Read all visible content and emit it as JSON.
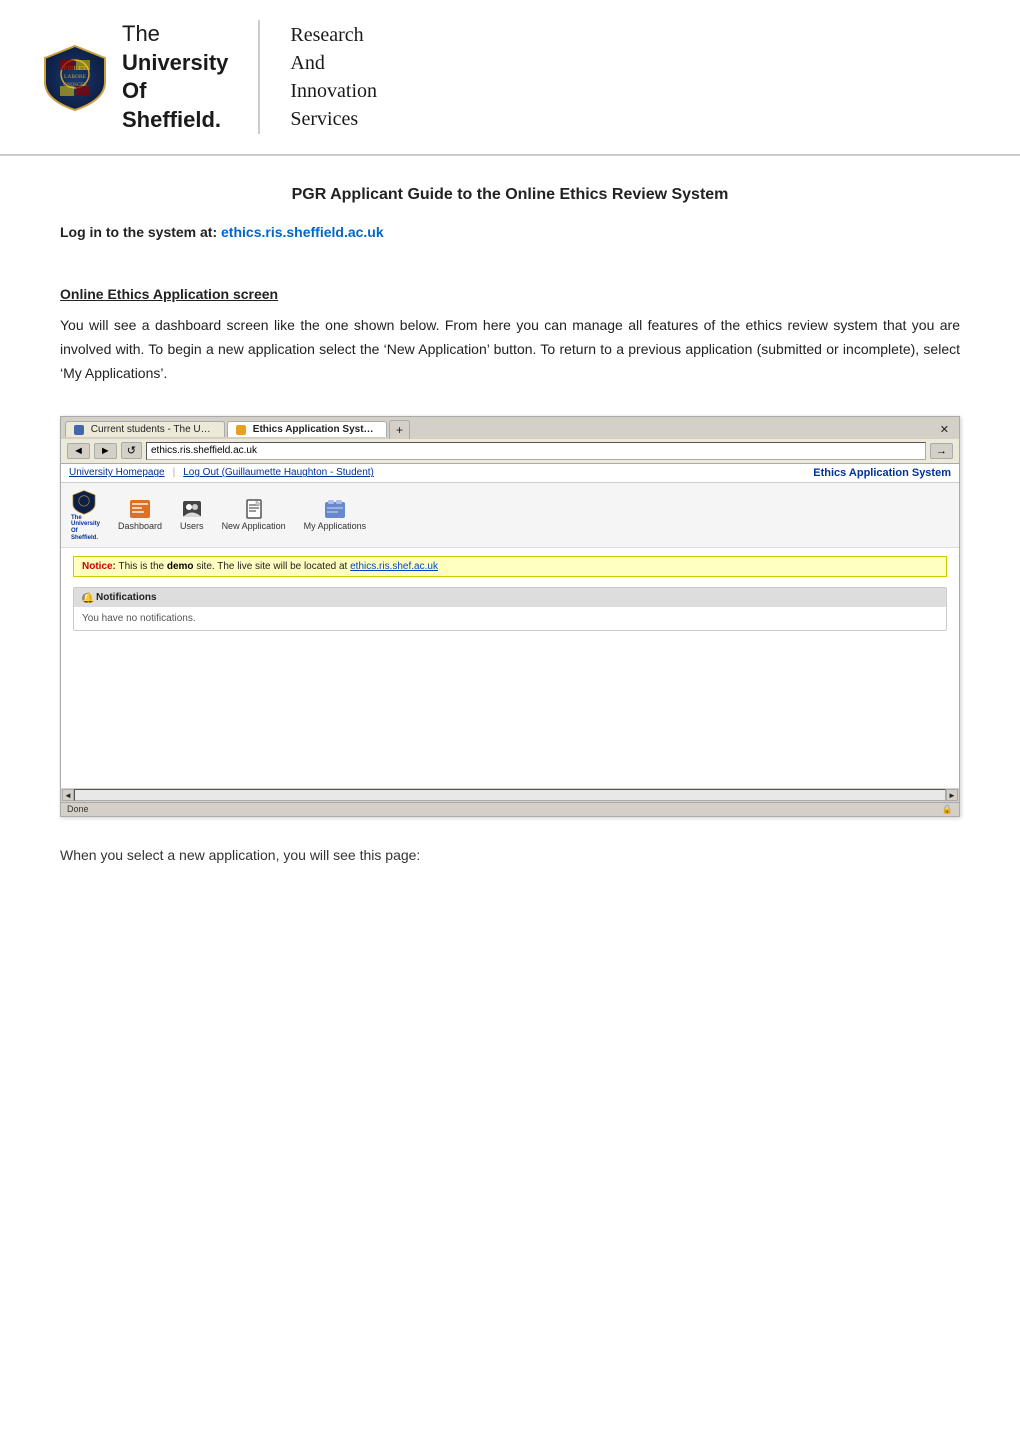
{
  "header": {
    "uni_line1": "The",
    "uni_line2": "University",
    "uni_line3": "Of",
    "uni_line4": "Sheffield.",
    "ris_line1": "Research",
    "ris_line2": "And",
    "ris_line3": "Innovation",
    "ris_line4": "Services"
  },
  "page": {
    "title": "PGR Applicant Guide to the Online Ethics Review System",
    "login_label": "Log in to the system at:",
    "login_link": "ethics.ris.sheffield.ac.uk",
    "section_heading": "Online Ethics Application screen",
    "section_body": "You will see a dashboard screen like the one shown below. From here you can manage all features of the ethics review system that you are involved with. To begin a new application select the ‘New Application’ button. To return to a previous application (submitted or incomplete), select ‘My Applications’.",
    "footer_text": "When you select a new application, you will see this page:"
  },
  "browser": {
    "tab1_label": "Current students - The University of S...",
    "tab2_label": "Ethics Application System - Dash...",
    "tab2_icon": "orange",
    "app_header_left_link": "University Homepage",
    "app_header_logout": "Log Out (Guillaumette Haughton - Student)",
    "app_header_right": "Ethics Application System",
    "toolbar": {
      "logo_line1": "The",
      "logo_line2": "University",
      "logo_line3": "Of",
      "logo_line4": "Sheffield.",
      "dashboard_label": "Dashboard",
      "users_label": "Users",
      "new_app_label": "New Application",
      "my_apps_label": "My Applications"
    },
    "notice_prefix": "Notice:",
    "notice_text": "This is the",
    "notice_demo": "demo",
    "notice_suffix": "site. The live site will be located at",
    "notice_link": "ethics.ris.shef.ac.uk",
    "notifications_header": "Notifications",
    "notifications_body": "You have no notifications.",
    "statusbar": "Done"
  }
}
